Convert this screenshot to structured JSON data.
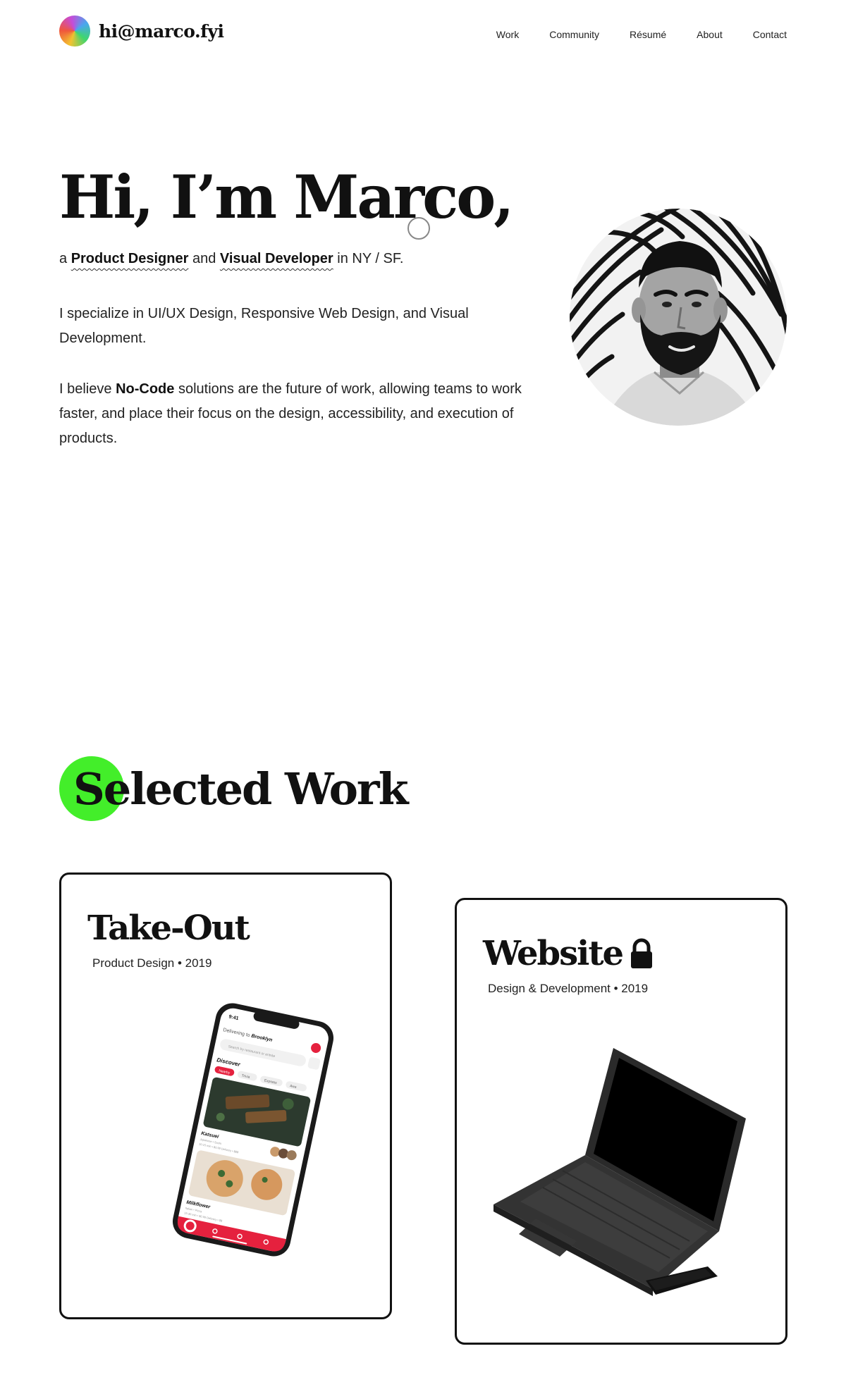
{
  "nav": {
    "brand": "hi@marco.fyi",
    "links": [
      "Work",
      "Community",
      "Résumé",
      "About",
      "Contact"
    ]
  },
  "hero": {
    "title": "Hi, I’m Marco,",
    "subtitle": {
      "prefix": "a",
      "role1": "Product Designer",
      "joiner": "and",
      "role2": "Visual Developer",
      "suffix": "in NY / SF."
    },
    "bio1": "I specialize in UI/UX Design, Responsive Web Design, and Visual Development.",
    "bio2": {
      "prefix": "I believe",
      "highlight": "No-Code",
      "suffix": "solutions are the future of work, allowing teams to work faster, and place their focus on the design, accessibility, and execution of products."
    }
  },
  "work": {
    "title": "Selected Work",
    "projects": [
      {
        "title": "Take-Out",
        "meta": "Product Design • 2019",
        "locked": false
      },
      {
        "title": "Website",
        "meta": "Design & Development • 2019",
        "locked": true
      }
    ]
  },
  "phone_app": {
    "time": "9:41",
    "delivering": "Delivering to",
    "location": "Brooklyn",
    "search_placeholder": "Search by restaurant or entrée",
    "discover": "Discover",
    "chips": [
      "Nearby",
      "Trivia",
      "Express",
      "Awa"
    ],
    "restaurant1": "Katsuei",
    "restaurant1_sub": "Japanese • Sushi",
    "restaurant1_info": "10-15 min • $0.99 Delivery • $$$",
    "restaurant2": "Milkflower",
    "restaurant2_sub": "Italian • Pizza",
    "restaurant2_info": "15-30 min • $0.99 Delivery • $$"
  },
  "colors": {
    "accent_green": "#43ee2a",
    "app_red": "#e5213e",
    "text": "#111111"
  }
}
